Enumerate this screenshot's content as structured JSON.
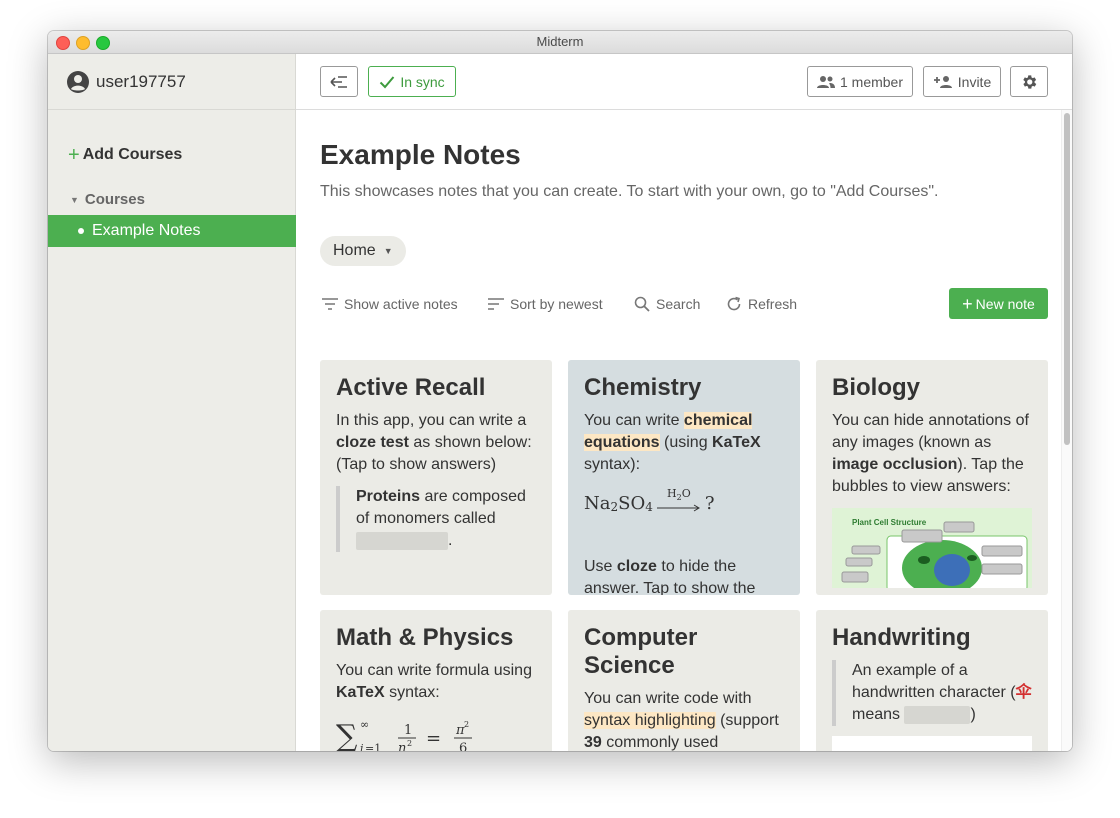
{
  "window": {
    "title": "Midterm"
  },
  "sidebar": {
    "username": "user197757",
    "add_courses": "Add Courses",
    "courses_header": "Courses",
    "items": [
      {
        "label": "Example Notes",
        "selected": true
      }
    ]
  },
  "topbar": {
    "collapse_icon": "collapse-sidebar-icon",
    "sync_label": "In sync",
    "member_label": "1 member",
    "invite_label": "Invite",
    "settings_icon": "gear-icon"
  },
  "main": {
    "title": "Example Notes",
    "subtitle": "This showcases notes that you can create. To start with your own, go to \"Add Courses\".",
    "folder_selector": "Home",
    "toolbar": {
      "filter_label": "Show active notes",
      "sort_label": "Sort by newest",
      "search_label": "Search",
      "refresh_label": "Refresh",
      "new_note_label": "New note"
    }
  },
  "cards": [
    {
      "title": "Active Recall",
      "text1": "In this app, you can write a",
      "bold1": "cloze test",
      "text2": "as shown below: (Tap to show answers)",
      "quote_bold": "Proteins",
      "quote_text": "are composed of monomers called",
      "quote_end": "."
    },
    {
      "title": "Chemistry",
      "text1": "You can write",
      "highlight": "chemical equations",
      "text2": "(using",
      "bold1": "KaTeX",
      "text3": "syntax):",
      "formula_left": "Na",
      "formula_sub1": "2",
      "formula_mid": "SO",
      "formula_sub2": "4",
      "formula_over": "H",
      "formula_over_sub": "2",
      "formula_over_end": "O",
      "formula_right": "?",
      "text4a": "Use",
      "bold2": "cloze",
      "text4b": "to hide the answer. Tap to show the answer."
    },
    {
      "title": "Biology",
      "text1": "You can hide annotations of any images (known as",
      "bold1": "image occlusion",
      "text2": "). Tap the bubbles to view answers:",
      "image_label": "Plant Cell Structure"
    },
    {
      "title": "Math & Physics",
      "text1": "You can write formula using",
      "bold1": "KaTeX",
      "text2": "syntax:"
    },
    {
      "title": "Computer Science",
      "text1": "You can write code with",
      "highlight": "syntax highlighting",
      "text2": "(support",
      "bold1": "39",
      "text3": "commonly used languages.)"
    },
    {
      "title": "Handwriting",
      "quote_text": "An example of a handwritten character (",
      "character": "伞",
      "quote_text2": "means",
      "quote_end": ")"
    }
  ],
  "colors": {
    "accent": "#4caf50",
    "sidebar_bg": "#edede8",
    "card_bg": "#ebebe6",
    "chem_card_bg": "#d5dde0",
    "highlight": "#fde7c4",
    "character_red": "#d32f2f"
  }
}
